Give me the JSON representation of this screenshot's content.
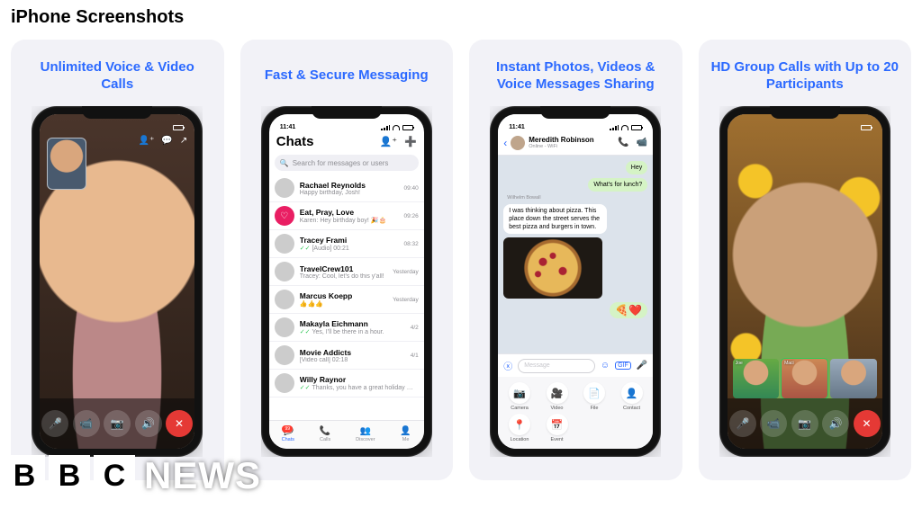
{
  "section_title": "iPhone Screenshots",
  "status_time": "11:41",
  "cards": [
    {
      "title": "Unlimited Voice & Video Calls"
    },
    {
      "title": "Fast & Secure Messaging"
    },
    {
      "title": "Instant Photos, Videos & Voice Messages Sharing"
    },
    {
      "title": "HD Group Calls with Up to 20 Participants"
    }
  ],
  "chats": {
    "header": "Chats",
    "search_placeholder": "Search for messages or users",
    "items": [
      {
        "name": "Rachael Reynolds",
        "preview": "Happy birthday, Josh!",
        "time": "09:40",
        "checks": false
      },
      {
        "name": "Eat, Pray, Love",
        "preview": "Karen: Hey birthday boy! 🎉🎂",
        "time": "09:26",
        "checks": false,
        "pink": true
      },
      {
        "name": "Tracey Frami",
        "preview": "[Audio] 00:21",
        "time": "08:32",
        "checks": true
      },
      {
        "name": "TravelCrew101",
        "preview": "Tracey: Cool, let's do this y'all!",
        "time": "Yesterday",
        "checks": false
      },
      {
        "name": "Marcus Koepp",
        "preview": "👍👍👍",
        "time": "Yesterday",
        "checks": false
      },
      {
        "name": "Makayla Eichmann",
        "preview": "Yes, I'll be there in a hour.",
        "time": "4/2",
        "checks": true
      },
      {
        "name": "Movie Addicts",
        "preview": "[Video call] 02:18",
        "time": "4/1",
        "checks": false
      },
      {
        "name": "Willy Raynor",
        "preview": "Thanks, you have a great holiday too…",
        "time": "",
        "checks": true
      }
    ],
    "tabs": [
      {
        "label": "Chats",
        "badge": "99"
      },
      {
        "label": "Calls"
      },
      {
        "label": "Discover"
      },
      {
        "label": "Me"
      }
    ]
  },
  "convo": {
    "contact": "Meredith Robinson",
    "status": "Online - WiFi",
    "msgs": {
      "hey": "Hey",
      "lunch": "What's for lunch?",
      "sender": "Wilhelm Bowall",
      "pizza_text": "I was thinking about pizza. This place down the street serves the best pizza and burgers in town.",
      "emoji": "🍕❤️"
    },
    "compose_placeholder": "Message",
    "attachments": [
      {
        "label": "Camera",
        "icon": "camera-icon",
        "glyph": "📷"
      },
      {
        "label": "Video",
        "icon": "video-icon",
        "glyph": "🎥"
      },
      {
        "label": "File",
        "icon": "file-icon",
        "glyph": "📄"
      },
      {
        "label": "Contact",
        "icon": "contact-icon",
        "glyph": "👤"
      },
      {
        "label": "Location",
        "icon": "location-icon",
        "glyph": "📍"
      },
      {
        "label": "Event",
        "icon": "event-icon",
        "glyph": "📅"
      }
    ]
  },
  "group": {
    "thumbs": [
      "Joe",
      "Maci",
      ""
    ]
  },
  "watermark": {
    "b1": "B",
    "b2": "B",
    "b3": "C",
    "news": "NEWS"
  }
}
